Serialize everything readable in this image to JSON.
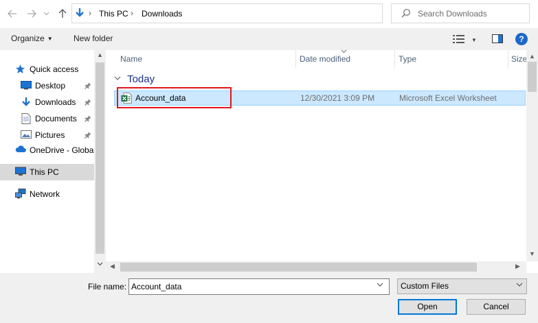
{
  "address": {
    "crumbs": [
      "This PC",
      "Downloads"
    ]
  },
  "search": {
    "placeholder": "Search Downloads"
  },
  "toolbar": {
    "organize": "Organize",
    "new_folder": "New folder"
  },
  "nav": {
    "items": [
      {
        "label": "Quick access",
        "icon": "star-icon"
      },
      {
        "label": "Desktop",
        "icon": "desktop-icon",
        "pinned": true
      },
      {
        "label": "Downloads",
        "icon": "download-icon",
        "pinned": true
      },
      {
        "label": "Documents",
        "icon": "documents-icon",
        "pinned": true
      },
      {
        "label": "Pictures",
        "icon": "pictures-icon",
        "pinned": true
      },
      {
        "label": "OneDrive - Global",
        "icon": "cloud-icon"
      },
      {
        "label": "This PC",
        "icon": "computer-icon",
        "selected": true
      },
      {
        "label": "Network",
        "icon": "network-icon"
      }
    ]
  },
  "columns": [
    "Name",
    "Date modified",
    "Type",
    "Size"
  ],
  "group": {
    "label": "Today"
  },
  "files": [
    {
      "name": "Account_data",
      "date": "12/30/2021 3:09 PM",
      "type": "Microsoft Excel Worksheet",
      "selected": true
    }
  ],
  "footer": {
    "file_name_label": "File name:",
    "file_name_value": "Account_data",
    "filter": "Custom Files",
    "open": "Open",
    "cancel": "Cancel"
  },
  "colors": {
    "accent": "#0078d7",
    "selection": "#cce8ff",
    "highlight": "#e0161b"
  }
}
